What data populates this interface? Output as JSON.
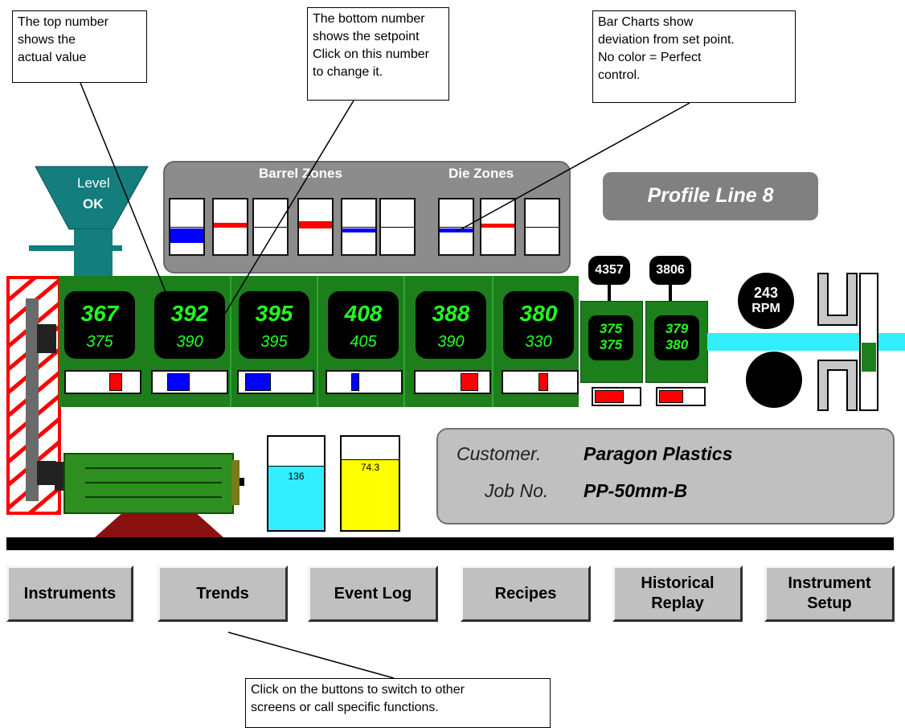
{
  "callouts": {
    "top_number": "The top number\nshows the\nactual value",
    "bottom_number": "The bottom number\nshows the setpoint\nClick on this number\nto change it.",
    "bar_charts": "Bar Charts show\ndeviation from set point.\nNo color = Perfect\ncontrol.",
    "buttons": "Click on the buttons to switch to other\nscreens or call specific functions."
  },
  "hopper": {
    "label": "Level",
    "status": "OK"
  },
  "zones": {
    "barrel_title": "Barrel Zones",
    "die_title": "Die Zones"
  },
  "line_title": "Profile Line 8",
  "barrel_zones": [
    {
      "actual": "367",
      "setpoint": "375"
    },
    {
      "actual": "392",
      "setpoint": "390"
    },
    {
      "actual": "395",
      "setpoint": "395"
    },
    {
      "actual": "408",
      "setpoint": "405"
    },
    {
      "actual": "388",
      "setpoint": "390"
    },
    {
      "actual": "380",
      "setpoint": "330"
    }
  ],
  "die_zones": [
    {
      "actual": "375",
      "setpoint": "375",
      "pressure": "4357"
    },
    {
      "actual": "379",
      "setpoint": "380",
      "pressure": "3806"
    }
  ],
  "screw_speed": {
    "value": "243",
    "unit": "RPM"
  },
  "tanks": [
    {
      "value": "136",
      "level": 0.68,
      "color": "#33eeff"
    },
    {
      "value": "74.3",
      "level": 0.75,
      "color": "#ffff00"
    }
  ],
  "job": {
    "customer_label": "Customer.",
    "customer_value": "Paragon Plastics",
    "job_label": "Job No.",
    "job_value": "PP-50mm-B"
  },
  "buttons": {
    "instruments": "Instruments",
    "trends": "Trends",
    "event_log": "Event Log",
    "recipes": "Recipes",
    "historical_replay": "Historical\nReplay",
    "instrument_setup": "Instrument\nSetup"
  },
  "colors": {
    "barrel_green": "#1c7f1c",
    "display_green": "#20ff20",
    "deviation_red": "#ff0000",
    "deviation_blue": "#0000ff"
  }
}
